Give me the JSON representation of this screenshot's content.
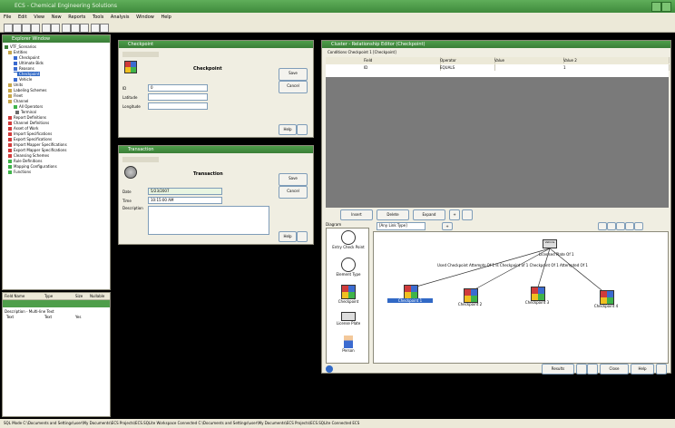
{
  "app": {
    "title": "ECS - Chemical Engineering Solutions"
  },
  "menu": [
    "File",
    "Edit",
    "View",
    "New",
    "Reports",
    "Tools",
    "Analysis",
    "Window",
    "Help"
  ],
  "explorer": {
    "title": "Explorer Window",
    "items": [
      "VTF_Scenarios",
      "Entities",
      "Checkpoint",
      "Ultimate Bids",
      "Reasons",
      "Checkpoint",
      "Vehicle",
      "Units",
      "Labeling Schemes",
      "Fleet",
      "Channel",
      "All Operators",
      "Terminal",
      "Report Definitions",
      "Channel Definitions",
      "Asset of Work",
      "Import Specifications",
      "Export Specifications",
      "Import Mapper Specifications",
      "Export Mapper Specifications",
      "Cleansing Schemes",
      "Rule Definitions",
      "Mapping Configurations",
      "Functions"
    ]
  },
  "props": {
    "headers": [
      "Field Name",
      "Type",
      "Size",
      "Nullable"
    ],
    "desc_label": "Description - Multi-line Text",
    "row": [
      "Text",
      "Text",
      "Yes"
    ]
  },
  "cp_form": {
    "title": "Checkpoint",
    "heading": "Checkpoint",
    "id_label": "ID",
    "id_value": "0",
    "lat_label": "Latitude",
    "lon_label": "Longitude",
    "save": "Save",
    "cancel": "Cancel",
    "help": "Help"
  },
  "tr_form": {
    "title": "Transaction",
    "heading": "Transaction",
    "date_label": "Date",
    "date_value": "5/23/2007",
    "time_label": "Time",
    "time_value": "10:15:00 AM",
    "desc_label": "Description",
    "save": "Save",
    "cancel": "Cancel",
    "help": "Help"
  },
  "relwin": {
    "title": "Cluster - Relationship Editor (Checkpoint)",
    "tabs_label": "Conditions   Checkpoint 1 [Checkpoint]",
    "grid_headers": [
      "Field",
      "Operator",
      "Value",
      "Value 2"
    ],
    "grid_row": [
      "ID",
      "EQUALS",
      "",
      "1"
    ],
    "buttons": [
      "Insert",
      "Delete",
      "Expand"
    ],
    "diagram_label": "Diagram",
    "combo": "[Any Link Type]",
    "palette": [
      "Entry Check Point",
      "Element Type",
      "Checkpoint",
      "License Plate",
      "Person"
    ],
    "root_label": "Vehicle",
    "edge_top": "Licensed Plate Of 1",
    "edge_main": "Used Checkpoint Attempts Of 1  Is Checkpoint of 1  Checkpoint Of 1  Attempted Of 1",
    "nodes": [
      "Checkpoint 1",
      "Checkpoint 2",
      "Checkpoint 3",
      "Checkpoint 4"
    ],
    "footer_buttons": [
      "Results",
      "Close",
      "Help"
    ]
  },
  "status": {
    "text": "SQL Mode  C:\\Documents and Settings\\user\\My Documents\\ECS Projects\\ECS.SQLite Workspace  Connected  C:\\Documents and Settings\\user\\My Documents\\ECS Projects\\ECS.SQLite  Connected  ECS"
  }
}
